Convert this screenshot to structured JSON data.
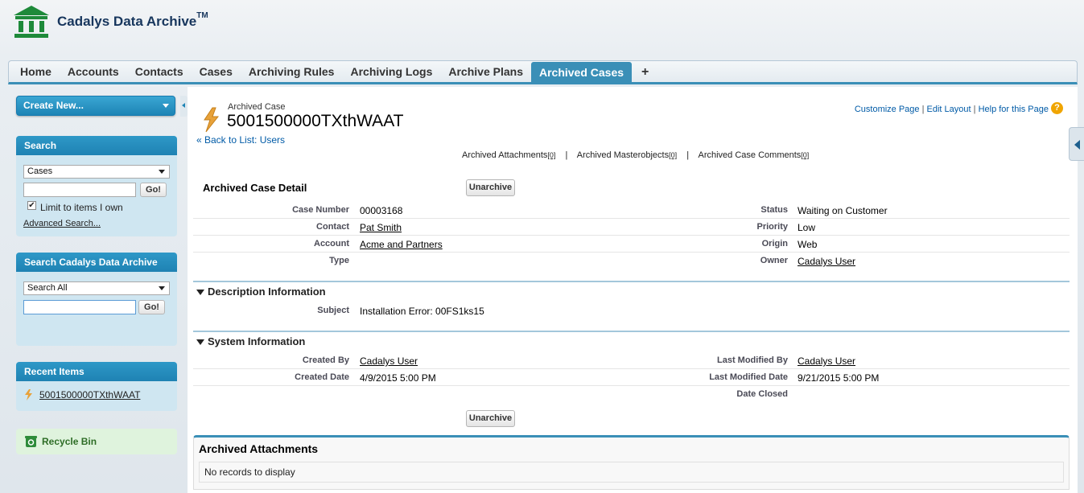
{
  "app": {
    "title": "Cadalys Data Archive",
    "trademark": "TM"
  },
  "tabs": [
    {
      "label": "Home"
    },
    {
      "label": "Accounts"
    },
    {
      "label": "Contacts"
    },
    {
      "label": "Cases"
    },
    {
      "label": "Archiving Rules"
    },
    {
      "label": "Archiving Logs"
    },
    {
      "label": "Archive Plans"
    },
    {
      "label": "Archived Cases",
      "active": true
    },
    {
      "label": "+"
    }
  ],
  "sidebar": {
    "create_new": "Create New...",
    "search": {
      "title": "Search",
      "scope": "Cases",
      "query": "",
      "go": "Go!",
      "limit_label": "Limit to items I own",
      "limit_checked": "✔",
      "advanced": "Advanced Search..."
    },
    "archive_search": {
      "title": "Search Cadalys Data Archive",
      "scope": "Search All",
      "query": "",
      "go": "Go!"
    },
    "recent": {
      "title": "Recent Items",
      "items": [
        "5001500000TXthWAAT"
      ]
    },
    "recycle_bin": "Recycle Bin"
  },
  "record": {
    "object_type": "Archived Case",
    "name": "5001500000TXthWAAT",
    "back_link": "« Back to List: Users",
    "top_links": {
      "customize": "Customize Page",
      "edit_layout": "Edit Layout",
      "help": "Help for this Page",
      "sep": "|"
    },
    "help_icon": "?",
    "related_links": [
      {
        "label": "Archived Attachments",
        "count": "[0]"
      },
      {
        "label": "Archived Masterobjects",
        "count": "[0]"
      },
      {
        "label": "Archived Case Comments",
        "count": "[0]"
      }
    ],
    "related_sep": "|",
    "detail_title": "Archived Case Detail",
    "unarchive": "Unarchive",
    "fields": {
      "case_number": {
        "label": "Case Number",
        "value": "00003168"
      },
      "status": {
        "label": "Status",
        "value": "Waiting on Customer"
      },
      "contact": {
        "label": "Contact",
        "value": "Pat Smith"
      },
      "priority": {
        "label": "Priority",
        "value": "Low"
      },
      "account": {
        "label": "Account",
        "value": "Acme and Partners"
      },
      "origin": {
        "label": "Origin",
        "value": "Web"
      },
      "type": {
        "label": "Type",
        "value": ""
      },
      "owner": {
        "label": "Owner",
        "value": "Cadalys User"
      }
    },
    "description": {
      "title": "Description Information",
      "subject": {
        "label": "Subject",
        "value": "Installation Error: 00FS1ks15"
      }
    },
    "system": {
      "title": "System Information",
      "created_by": {
        "label": "Created By",
        "value": "Cadalys User"
      },
      "last_modified_by": {
        "label": "Last Modified By",
        "value": "Cadalys User"
      },
      "created_date": {
        "label": "Created Date",
        "value": "4/9/2015 5:00 PM"
      },
      "last_modified_date": {
        "label": "Last Modified Date",
        "value": "9/21/2015 5:00 PM"
      },
      "date_closed": {
        "label": "Date Closed",
        "value": ""
      }
    },
    "attachments": {
      "title": "Archived Attachments",
      "empty": "No records to display"
    }
  },
  "colors": {
    "accent": "#3a8fb7",
    "header_text": "#17365d",
    "logo_green": "#1e8a3a"
  }
}
